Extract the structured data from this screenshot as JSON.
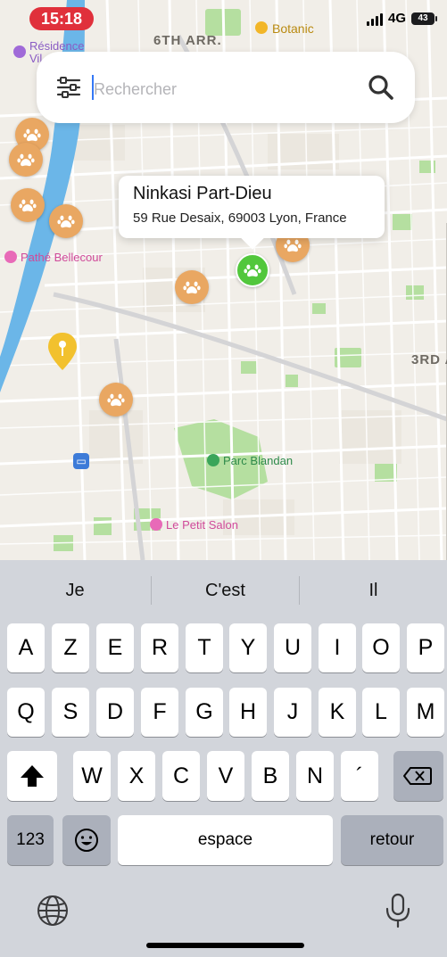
{
  "status_bar": {
    "time": "15:18",
    "network": "4G",
    "battery": "43"
  },
  "search": {
    "placeholder": "Rechercher",
    "value": ""
  },
  "map": {
    "labels": {
      "district_6": "6TH ARR.",
      "district_3": "3RD A",
      "botanic": "Botanic",
      "residence": "Résidence Vil",
      "pathe": "Pathé Bellecour",
      "parc": "Parc Blandan",
      "petit_salon": "Le Petit Salon"
    },
    "callout": {
      "name": "Ninkasi Part-Dieu",
      "address": "59 Rue Desaix, 69003 Lyon, France"
    },
    "pin_icon": "paw-icon",
    "colors": {
      "pin_default": "#e9a762",
      "pin_selected": "#52c73c",
      "pin_yellow": "#f2c12e",
      "water": "#6bb6e8",
      "park": "#b5dfa0"
    }
  },
  "keyboard": {
    "suggestions": [
      "Je",
      "C'est",
      "Il"
    ],
    "row1": [
      "A",
      "Z",
      "E",
      "R",
      "T",
      "Y",
      "U",
      "I",
      "O",
      "P"
    ],
    "row2": [
      "Q",
      "S",
      "D",
      "F",
      "G",
      "H",
      "J",
      "K",
      "L",
      "M"
    ],
    "row3": [
      "W",
      "X",
      "C",
      "V",
      "B",
      "N",
      "´"
    ],
    "numbers_key": "123",
    "space_key": "espace",
    "return_key": "retour"
  }
}
